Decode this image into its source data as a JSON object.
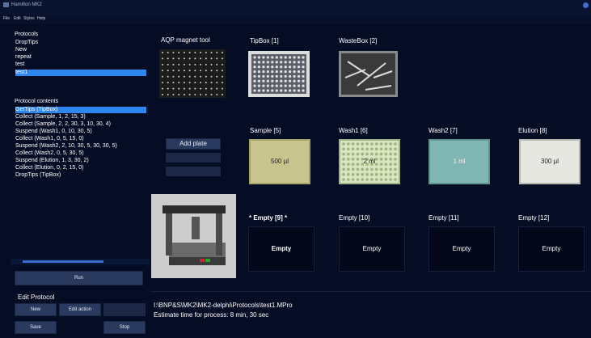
{
  "window": {
    "title": "Hamilton MK2"
  },
  "menu": [
    "File",
    "Edit",
    "Styles",
    "Help"
  ],
  "protocols": {
    "label": "Protocols",
    "items": [
      "DropTips",
      "New",
      "repeat",
      "test",
      "test1"
    ],
    "selected_index": 4
  },
  "protocol_contents": {
    "label": "Protocol contents",
    "items": [
      "GetTips (TipBox)",
      "Collect (Sample, 1, 2, 15, 3)",
      "Collect (Sample, 2, 2, 30, 3, 10, 30, 4)",
      "Suspend (Wash1, 0, 10, 30, 5)",
      "Collect (Wash1, 0, 5, 15, 0)",
      "Suspend (Wash2, 2, 10, 30, 5, 30, 30, 5)",
      "Collect (Wash2, 0, 5, 30, 5)",
      "Suspend (Elution, 1, 3, 30, 2)",
      "Collect (Elution, 0, 2, 15, 0)",
      "DropTips (TipBox)"
    ],
    "selected_index": 0
  },
  "buttons": {
    "run": "Run",
    "edit_protocol_label": "Edit Protocol",
    "new": "New",
    "edit_action": "Edit action",
    "save": "Save",
    "stop": "Stop",
    "add_plate": "Add plate"
  },
  "aqp": {
    "title": "AQP magnet tool"
  },
  "slots": {
    "tipbox": "TipBox [1]",
    "wastebox": "WasteBox [2]",
    "sample": {
      "title": "Sample [5]",
      "volume": "500 µl",
      "color": "#c7c58d"
    },
    "wash1": {
      "title": "Wash1 [6]",
      "volume": "2 ml",
      "color": "#d9e6c0"
    },
    "wash2": {
      "title": "Wash2 [7]",
      "volume": "1 ml",
      "color": "#7fb6b4"
    },
    "elution": {
      "title": "Elution [8]",
      "volume": "300 µl",
      "color": "#e7e7e2"
    },
    "empty9": {
      "title": "* Empty [9] *",
      "content": "Empty"
    },
    "empty10": {
      "title": "Empty [10]",
      "content": "Empty"
    },
    "empty11": {
      "title": "Empty [11]",
      "content": "Empty"
    },
    "empty12": {
      "title": "Empty [12]",
      "content": "Empty"
    }
  },
  "status": {
    "path": "I:\\BNP&S\\MK2\\MK2-delphi\\Protocols\\test1.MPro",
    "estimate": "Estimate time for process: 8 min, 30 sec"
  }
}
